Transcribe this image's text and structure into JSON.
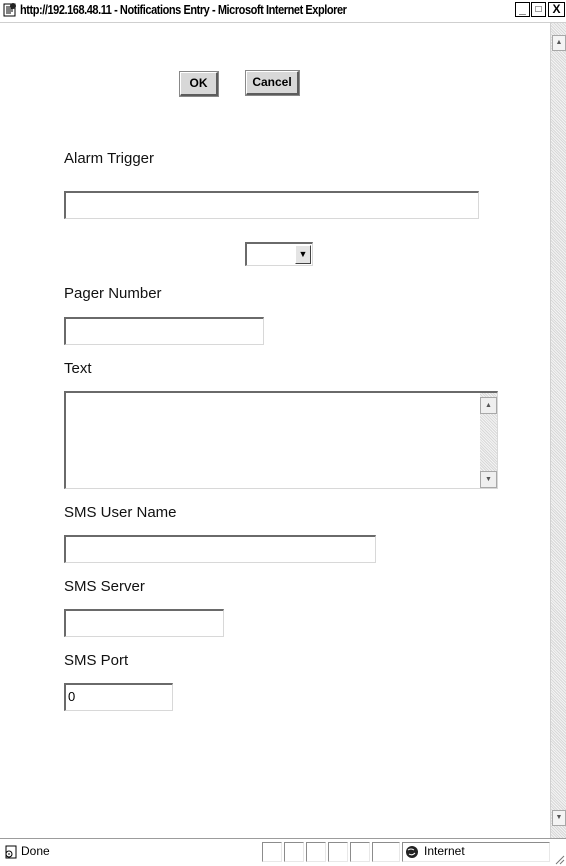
{
  "window": {
    "title": "http://192.168.48.11 - Notifications Entry - Microsoft Internet Explorer",
    "minimize": "_",
    "maximize": "□",
    "close": "X"
  },
  "toolbar": {
    "ok_label": "OK",
    "cancel_label": "Cancel"
  },
  "form": {
    "alarm_trigger": {
      "label": "Alarm Trigger",
      "value": ""
    },
    "select": {
      "value": ""
    },
    "pager_number": {
      "label": "Pager Number",
      "value": ""
    },
    "text": {
      "label": "Text",
      "value": ""
    },
    "sms_user_name": {
      "label": "SMS User Name",
      "value": ""
    },
    "sms_server": {
      "label": "SMS Server",
      "value": ""
    },
    "sms_port": {
      "label": "SMS Port",
      "value": "0"
    }
  },
  "statusbar": {
    "status": "Done",
    "zone": "Internet"
  },
  "icons": {
    "title": "ie-page-icon",
    "status": "page-done-icon",
    "zone": "internet-globe-icon"
  }
}
